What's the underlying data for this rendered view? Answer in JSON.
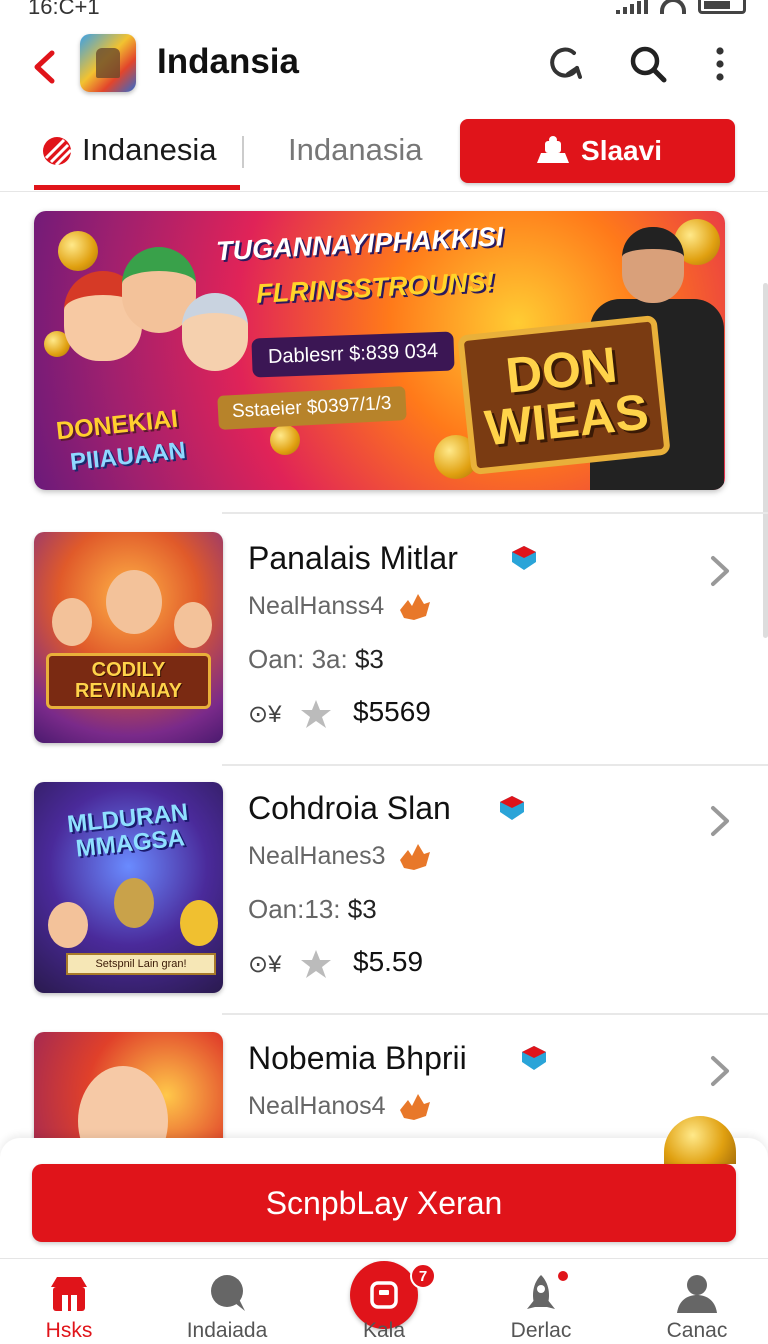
{
  "status_bar": {
    "time": "16:C+1"
  },
  "header": {
    "title": "Indansia"
  },
  "tabs": [
    {
      "label": "Indanesia"
    },
    {
      "label": "Indanasia"
    },
    {
      "label": "Slaavi"
    }
  ],
  "banner": {
    "headline_line1": "TUGANNAYIPHAKKISI",
    "headline_line2": "FLRINSSTROUNS!",
    "pill1": "Dablesrr $:839 034",
    "pill2": "Sstaeier $0397/1/3",
    "left_word1": "DONEKIAI",
    "left_word2": "PIIAUAAN",
    "sign_line1": "DON",
    "sign_line2": "WIEAS"
  },
  "items": [
    {
      "title": "Panalais Mitlar",
      "subtitle": "NealHanss4",
      "meta_label": "Oan: 3a:",
      "meta_value": "$3",
      "rating_icon": "⊙¥",
      "price": "$5569",
      "thumb_caption": "CODILY REVINAIAY"
    },
    {
      "title": "Cohdroia Slan",
      "subtitle": "NealHanes3",
      "meta_label": "Oan:13:",
      "meta_value": "$3",
      "rating_icon": "⊙¥",
      "price": "$5.59",
      "thumb_title": "MLDURAN MMAGSA",
      "thumb_strip": "Setspnil Lain gran!"
    },
    {
      "title": "Nobemia Bhprii",
      "subtitle": "NealHanos4"
    }
  ],
  "cta": {
    "label": "ScnpbLay Xeran"
  },
  "bottom_nav": [
    {
      "label": "Hsks",
      "icon": "store-icon"
    },
    {
      "label": "Indaiada",
      "icon": "chat-icon"
    },
    {
      "label": "Kala",
      "icon": "cart-icon",
      "badge": "7"
    },
    {
      "label": "Derlac",
      "icon": "rocket-icon"
    },
    {
      "label": "Canac",
      "icon": "profile-icon"
    }
  ],
  "colors": {
    "accent": "#e0141a",
    "text": "#111111",
    "muted": "#666666"
  }
}
